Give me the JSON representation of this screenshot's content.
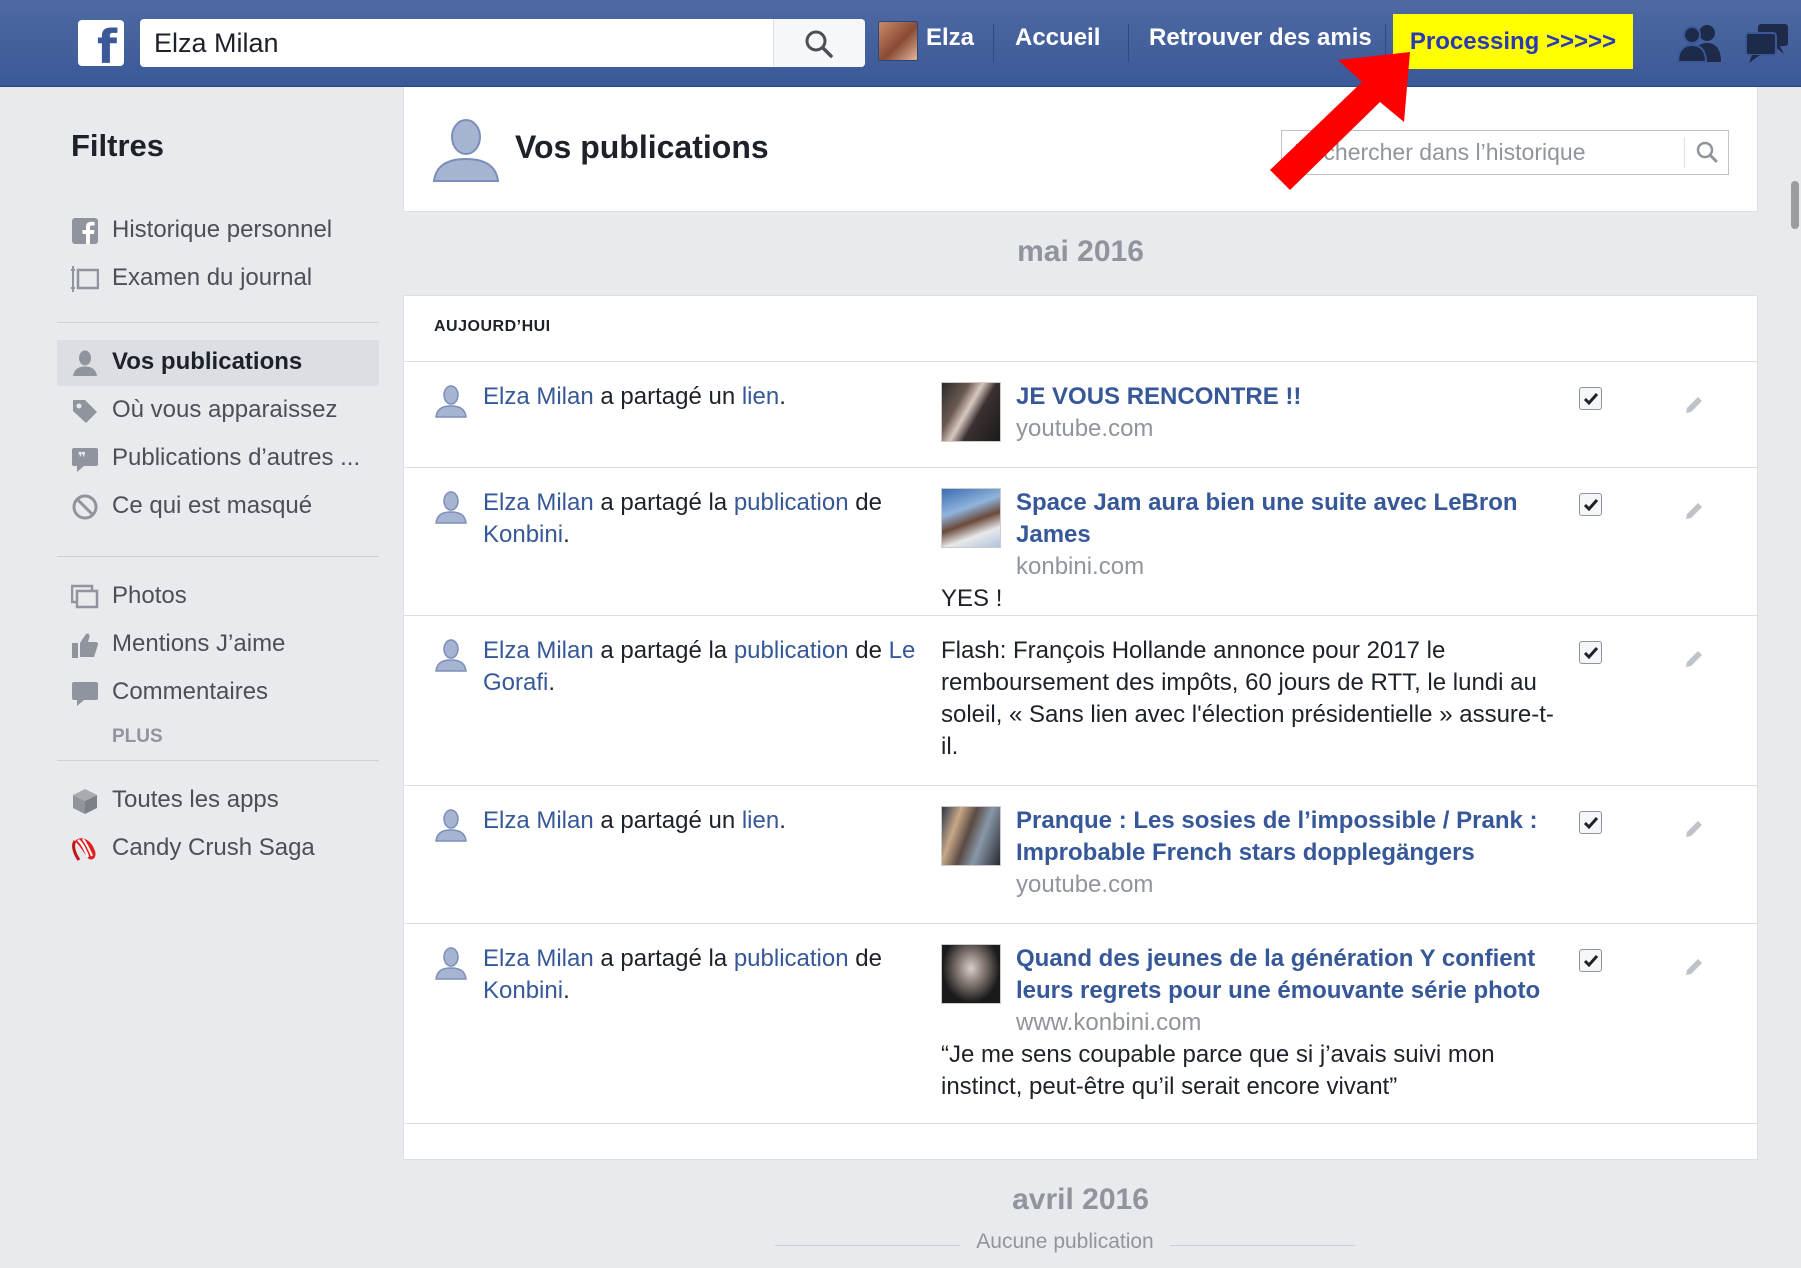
{
  "topbar": {
    "logo": "f",
    "search_value": "Elza Milan",
    "profile_name": "Elza",
    "nav_home": "Accueil",
    "nav_find_friends": "Retrouver des amis",
    "processing_label": "Processing >>>>>",
    "brand_color": "#3b5998",
    "highlight_color": "#ffff00",
    "arrow_color": "#ff0000"
  },
  "sidebar": {
    "title": "Filtres",
    "group1": [
      {
        "label": "Historique personnel",
        "icon": "facebook-icon"
      },
      {
        "label": "Examen du journal",
        "icon": "journal-review-icon"
      }
    ],
    "group2": [
      {
        "label": "Vos publications",
        "icon": "person-icon",
        "active": true
      },
      {
        "label": "Où vous apparaissez",
        "icon": "tag-icon"
      },
      {
        "label": "Publications d’autres ...",
        "icon": "quote-bubble-icon"
      },
      {
        "label": "Ce qui est masqué",
        "icon": "hidden-icon"
      }
    ],
    "group3": [
      {
        "label": "Photos",
        "icon": "photos-icon"
      },
      {
        "label": "Mentions J’aime",
        "icon": "like-icon"
      },
      {
        "label": "Commentaires",
        "icon": "comment-icon"
      }
    ],
    "more": "PLUS",
    "group4": [
      {
        "label": "Toutes les apps",
        "icon": "apps-cube-icon"
      },
      {
        "label": "Candy Crush Saga",
        "icon": "candy-icon"
      }
    ]
  },
  "header": {
    "title": "Vos publications",
    "history_search_placeholder": "Rechercher dans l’historique"
  },
  "months": {
    "current": "mai 2016",
    "previous": "avril 2016",
    "no_publication": "Aucune publication"
  },
  "feed": {
    "section_label": "AUJOURD’HUI",
    "rows": [
      {
        "actor": "Elza Milan",
        "verb": " a partagé un ",
        "object": "lien",
        "end": ".",
        "title": "JE VOUS RENCONTRE !!",
        "domain": "youtube.com"
      },
      {
        "actor": "Elza Milan",
        "verb": " a partagé la ",
        "object": "publication",
        "of": " de ",
        "page": "Konbini",
        "end": ".",
        "title": "Space Jam aura bien une suite avec LeBron James",
        "domain": "konbini.com",
        "quote": "YES !"
      },
      {
        "actor": "Elza Milan",
        "verb": " a partagé la ",
        "object": "publication",
        "of": " de ",
        "page": "Le Gorafi",
        "end": ".",
        "text": "Flash: François Hollande annonce pour 2017 le remboursement des impôts, 60 jours de RTT, le lundi au soleil, « Sans lien avec l'élection présidentielle » assure-t-il."
      },
      {
        "actor": "Elza Milan",
        "verb": " a partagé un ",
        "object": "lien",
        "end": ".",
        "title": "Pranque : Les sosies de l’impossible / Prank : Improbable French stars dopplegängers",
        "domain": "youtube.com"
      },
      {
        "actor": "Elza Milan",
        "verb": " a partagé la ",
        "object": "publication",
        "of": " de ",
        "page": "Konbini",
        "end": ".",
        "title": "Quand des jeunes de la génération Y confient leurs regrets pour une émouvante série photo",
        "domain": "www.konbini.com",
        "quote": "“Je me sens coupable parce que si j’avais suivi mon instinct, peut-être qu’il serait encore vivant”"
      }
    ]
  }
}
